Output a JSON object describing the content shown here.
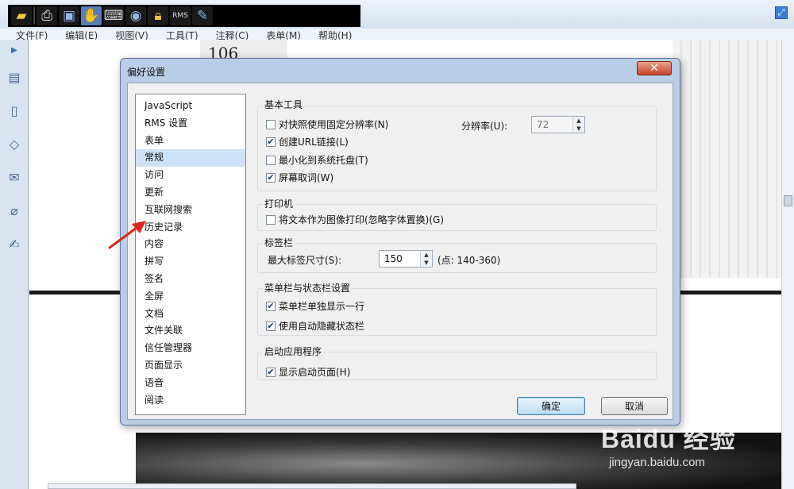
{
  "app": {
    "menu": [
      "文件(F)",
      "编辑(E)",
      "视图(V)",
      "工具(T)",
      "注释(C)",
      "表单(M)",
      "帮助(H)"
    ],
    "toolbar_icons": [
      "open-folder-icon",
      "print-icon",
      "screen-icon",
      "hand-tool-icon",
      "typewriter-icon",
      "camera-icon",
      "lock-icon",
      "rms-icon",
      "pen-icon"
    ],
    "toolbar_rms_label": "RMS",
    "doc_page_number": "106",
    "watermark_logo": "Baidu 经验",
    "watermark_url": "jingyan.baidu.com"
  },
  "dialog": {
    "title": "偏好设置",
    "close_symbol": "✕",
    "categories": [
      "JavaScript",
      "RMS 设置",
      "表单",
      "常规",
      "访问",
      "更新",
      "互联网搜索",
      "历史记录",
      "内容",
      "拼写",
      "签名",
      "全屏",
      "文档",
      "文件关联",
      "信任管理器",
      "页面显示",
      "语音",
      "阅读"
    ],
    "selected_category": "常规",
    "groups": {
      "basic_tools": {
        "title": "基本工具",
        "fixed_resolution": {
          "label": "对快照使用固定分辨率(N)",
          "checked": false
        },
        "resolution_label": "分辨率(U):",
        "resolution_value": "72",
        "create_url_links": {
          "label": "创建URL链接(L)",
          "checked": true
        },
        "minimize_to_tray": {
          "label": "最小化到系统托盘(T)",
          "checked": false
        },
        "screen_word_capture": {
          "label": "屏幕取词(W)",
          "checked": true
        }
      },
      "printer": {
        "title": "打印机",
        "print_text_as_image": {
          "label": "将文本作为图像打印(忽略字体置换)(G)",
          "checked": false
        }
      },
      "tab_bar": {
        "title": "标签栏",
        "max_tab_size_label": "最大标签尺寸(S):",
        "max_tab_size_value": "150",
        "max_tab_size_hint": "(点: 140-360)"
      },
      "menu_status_bar": {
        "title": "菜单栏与状态栏设置",
        "menu_single_line": {
          "label": "菜单栏单独显示一行",
          "checked": true
        },
        "auto_hide_status_bar": {
          "label": "使用自动隐藏状态栏",
          "checked": true
        }
      },
      "startup": {
        "title": "启动应用程序",
        "show_start_page": {
          "label": "显示启动页面(H)",
          "checked": true
        }
      }
    },
    "ok_label": "确定",
    "cancel_label": "取消"
  },
  "colors": {
    "selected_row": "#cde2f8",
    "annotation_arrow": "#d9261c",
    "close_button": "#c7432a"
  }
}
